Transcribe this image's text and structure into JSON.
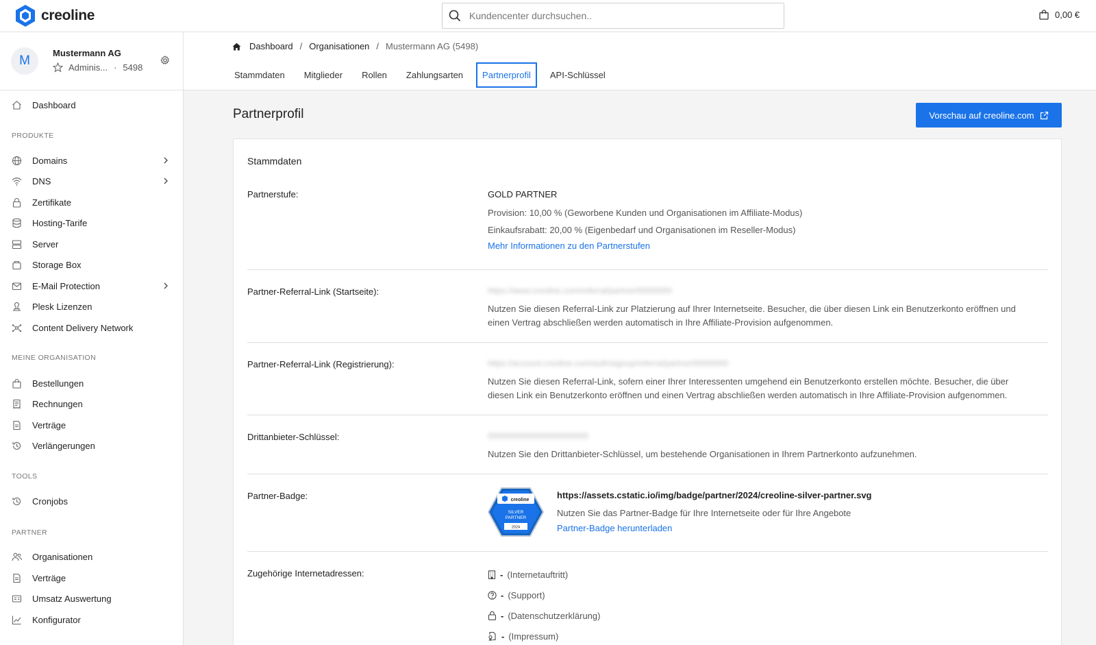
{
  "brand": {
    "name": "creoline",
    "color": "#1a73e8"
  },
  "search": {
    "placeholder": "Kundencenter durchsuchen.."
  },
  "cart": {
    "amount": "0,00 €"
  },
  "org": {
    "initial": "M",
    "name": "Mustermann AG",
    "role": "Adminis...",
    "separator": "·",
    "id": "5498"
  },
  "sidebar": {
    "dashboard": "Dashboard",
    "sections": {
      "produkte": "PRODUKTE",
      "organisation": "MEINE ORGANISATION",
      "tools": "TOOLS",
      "partner": "PARTNER"
    },
    "produkte": [
      "Domains",
      "DNS",
      "Zertifikate",
      "Hosting-Tarife",
      "Server",
      "Storage Box",
      "E-Mail Protection",
      "Plesk Lizenzen",
      "Content Delivery Network"
    ],
    "organisation": [
      "Bestellungen",
      "Rechnungen",
      "Verträge",
      "Verlängerungen"
    ],
    "tools": [
      "Cronjobs"
    ],
    "partner": [
      "Organisationen",
      "Verträge",
      "Umsatz Auswertung",
      "Konfigurator"
    ]
  },
  "breadcrumb": {
    "home": "Dashboard",
    "sep": "/",
    "org": "Organisationen",
    "current": "Mustermann AG (5498)"
  },
  "tabs": [
    "Stammdaten",
    "Mitglieder",
    "Rollen",
    "Zahlungsarten",
    "Partnerprofil",
    "API-Schlüssel"
  ],
  "page": {
    "title": "Partnerprofil",
    "preview_button": "Vorschau auf creoline.com"
  },
  "card": {
    "title": "Stammdaten",
    "partnerstufe": {
      "label": "Partnerstufe:",
      "level": "GOLD PARTNER",
      "provision": "Provision: 10,00 % (Geworbene Kunden und Organisationen im Affiliate-Modus)",
      "rabatt": "Einkaufsrabatt: 20,00 % (Eigenbedarf und Organisationen im Reseller-Modus)",
      "link": "Mehr Informationen zu den Partnerstufen"
    },
    "referral_start": {
      "label": "Partner-Referral-Link (Startseite):",
      "value": "https://www.creoline.com/referral/partner00000000",
      "desc_1": "Nutzen Sie diesen Referral-Link zur Platzierung auf Ihrer Internetseite. Besucher, die über diesen Link ein Benutzerkonto eröffnen und",
      "desc_2": "einen Vertrag abschließen werden automatisch in Ihre Affiliate-Provision aufgenommen."
    },
    "referral_reg": {
      "label": "Partner-Referral-Link (Registrierung):",
      "value": "https://account.creoline.com/auth/signup/referral/partner00000000",
      "desc_1": "Nutzen Sie diesen Referral-Link, sofern einer Ihrer Interessenten umgehend ein Benutzerkonto erstellen möchte. Besucher, die über",
      "desc_2": "diesen Link ein Benutzerkonto eröffnen und einen Vertrag abschließen werden automatisch in Ihre Affiliate-Provision aufgenommen."
    },
    "drittanbieter": {
      "label": "Drittanbieter-Schlüssel:",
      "value": "0000000000000000000000",
      "desc": "Nutzen Sie den Drittanbieter-Schlüssel, um bestehende Organisationen in Ihrem Partnerkonto aufzunehmen."
    },
    "badge": {
      "label": "Partner-Badge:",
      "badge_brand": "creoline",
      "badge_level_1": "SILVER",
      "badge_level_2": "PARTNER",
      "badge_year": "2024",
      "url": "https://assets.cstatic.io/img/badge/partner/2024/creoline-silver-partner.svg",
      "desc": "Nutzen Sie das Partner-Badge für Ihre Internetseite oder für Ihre Angebote",
      "link": "Partner-Badge herunterladen"
    },
    "addresses": {
      "label": "Zugehörige Internetadressen:",
      "items": [
        {
          "value": "-",
          "type": "(Internetauftritt)",
          "icon": "building-icon"
        },
        {
          "value": "-",
          "type": "(Support)",
          "icon": "help-circle-icon"
        },
        {
          "value": "-",
          "type": "(Datenschutzerklärung)",
          "icon": "lock-icon"
        },
        {
          "value": "-",
          "type": "(Impressum)",
          "icon": "document-stamp-icon"
        }
      ]
    }
  }
}
